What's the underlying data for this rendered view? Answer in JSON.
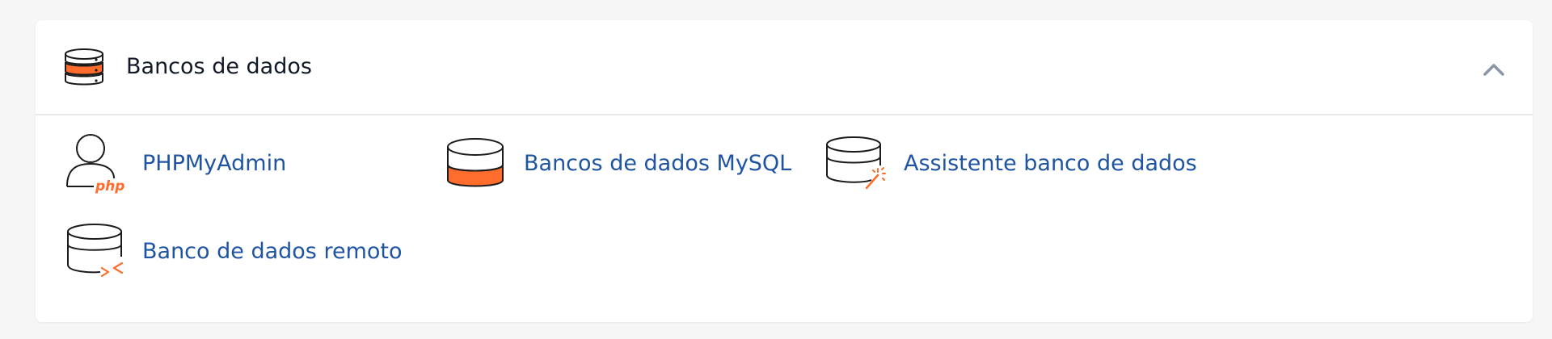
{
  "section": {
    "title": "Bancos de dados",
    "header_icon": "database-stack-icon",
    "toggle_icon": "chevron-up-icon"
  },
  "colors": {
    "accent": "#ff6c2c",
    "link": "#1f54a3",
    "title": "#111827",
    "icon_stroke": "#1b1b1b",
    "chevron": "#8896a6",
    "background": "#f6f6f6"
  },
  "items": [
    {
      "label": "PHPMyAdmin",
      "icon": "phpmyadmin-user-icon",
      "icon_text": "php"
    },
    {
      "label": "Bancos de dados MySQL",
      "icon": "mysql-database-icon"
    },
    {
      "label": "Assistente banco de dados",
      "icon": "database-wizard-icon"
    },
    {
      "label": "Banco de dados remoto",
      "icon": "remote-database-icon"
    }
  ]
}
